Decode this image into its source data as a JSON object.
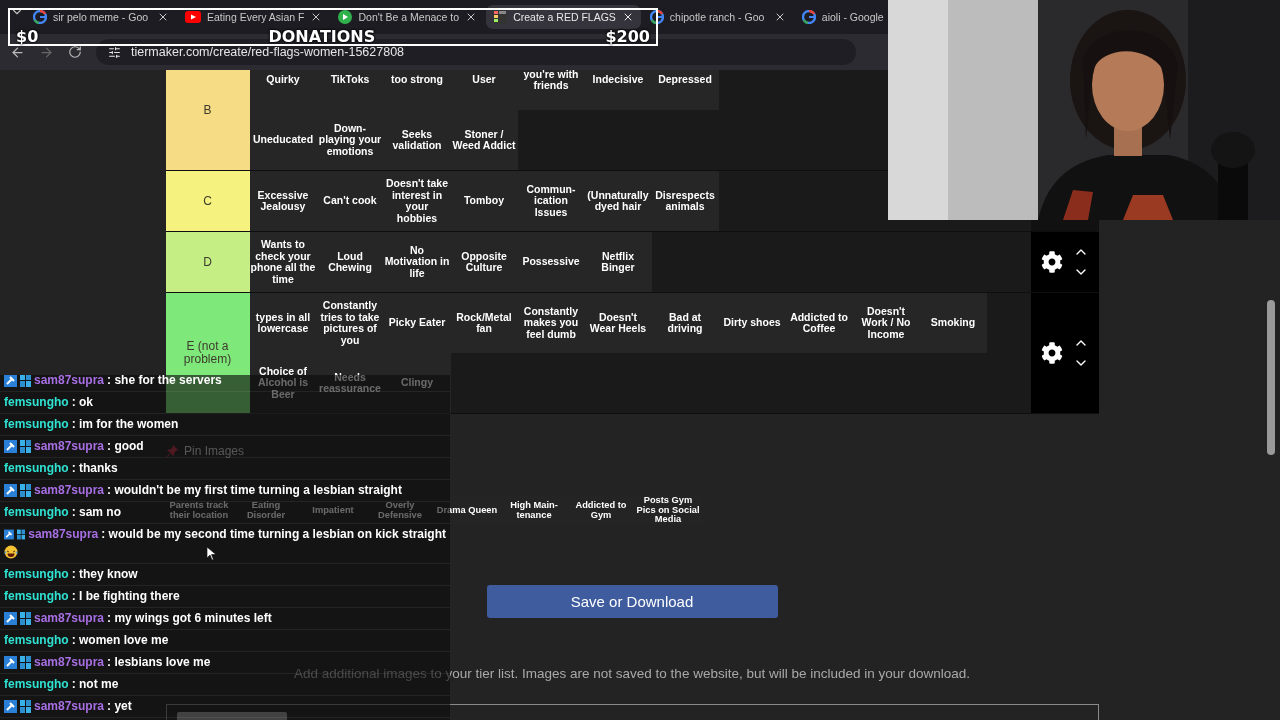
{
  "browser": {
    "tabs": [
      {
        "title": "sir pelo meme - Goo",
        "kind": "google",
        "selected": false
      },
      {
        "title": "Eating Every Asian F",
        "kind": "video",
        "selected": false
      },
      {
        "title": "Don't Be a Menace to",
        "kind": "play",
        "selected": false
      },
      {
        "title": "Create a RED FLAGS",
        "kind": "grid",
        "selected": true
      },
      {
        "title": "chipotle ranch - Goo",
        "kind": "google",
        "selected": false
      },
      {
        "title": "aioli - Google",
        "kind": "google",
        "selected": false
      }
    ],
    "url": "tiermaker.com/create/red-flags-women-15627808"
  },
  "donations": {
    "start": "$0",
    "title": "DONATIONS",
    "goal": "$200",
    "level": 0
  },
  "tier_list": {
    "tiers": [
      {
        "label": "B",
        "color": "#f7dc86",
        "lines": [
          [
            "Quirky",
            "TikToks",
            "too strong",
            "User",
            "you're with friends",
            "Indecisive",
            "Depressed"
          ],
          [
            "Uneducated",
            "Down-playing your emotions",
            "Seeks validation",
            "Stoner / Weed Addict"
          ]
        ]
      },
      {
        "label": "C",
        "color": "#f6f27f",
        "lines": [
          [
            "Excessive Jealousy",
            "Can't cook",
            "Doesn't take interest in your hobbies",
            "Tomboy",
            "Commun-ication Issues",
            "(Unnaturally dyed hair",
            "Disrespects animals"
          ]
        ]
      },
      {
        "label": "D",
        "color": "#c5ef84",
        "controls": true,
        "lines": [
          [
            "Wants to check your phone all the time",
            "Loud Chewing",
            "No Motivation in life",
            "Opposite Culture",
            "Possessive",
            "Netflix Binger"
          ]
        ]
      },
      {
        "label": "E (not a problem)",
        "color": "#7fe87a",
        "controls": true,
        "lines": [
          [
            "types in all lowercase",
            "Constantly tries to take pictures of you",
            "Picky Eater",
            "Rock/Metal fan",
            "Constantly makes you feel dumb",
            "Doesn't Wear Heels",
            "Bad at driving",
            "Dirty shoes",
            "Addicted to Coffee",
            "Doesn't Work / No Income",
            "Smoking"
          ],
          [
            "Choice of Alcohol is Beer",
            "Needs reassurance",
            "Clingy"
          ]
        ]
      }
    ]
  },
  "pin_images": "Pin Images",
  "unplaced_items": [
    "Parents track their location",
    "Eating Disorder",
    "Impatient",
    "Overly Defensive",
    "Drama Queen",
    "High Main-tenance",
    "Addicted to Gym",
    "Posts Gym Pics on Social Media"
  ],
  "save_button": "Save or Download",
  "help_text": "Add additional images to your tier list. Images are not saved to the website, but will be included in your download.",
  "chat": [
    {
      "user": "sam87supra",
      "color": "#a76fe3",
      "badged": true,
      "text": ": she for the servers",
      "emote": false
    },
    {
      "user": "femsungho",
      "color": "#2fe3d3",
      "badged": false,
      "text": ": ok",
      "emote": false
    },
    {
      "user": "femsungho",
      "color": "#2fe3d3",
      "badged": false,
      "text": ": im for the women",
      "emote": false
    },
    {
      "user": "sam87supra",
      "color": "#a76fe3",
      "badged": true,
      "text": ": good",
      "emote": false
    },
    {
      "user": "femsungho",
      "color": "#2fe3d3",
      "badged": false,
      "text": ": thanks",
      "emote": false
    },
    {
      "user": "sam87supra",
      "color": "#a76fe3",
      "badged": true,
      "text": ": wouldn't be my first time turning a lesbian straight",
      "emote": false
    },
    {
      "user": "femsungho",
      "color": "#2fe3d3",
      "badged": false,
      "text": ": sam no",
      "emote": false
    },
    {
      "user": "sam87supra",
      "color": "#a76fe3",
      "badged": true,
      "text": ": would be my second time turning a lesbian on kick straight",
      "emote": true
    },
    {
      "user": "femsungho",
      "color": "#2fe3d3",
      "badged": false,
      "text": ": they know",
      "emote": false
    },
    {
      "user": "femsungho",
      "color": "#2fe3d3",
      "badged": false,
      "text": ": I be fighting there",
      "emote": false
    },
    {
      "user": "sam87supra",
      "color": "#a76fe3",
      "badged": true,
      "text": ": my wings got 6 minutes left",
      "emote": false
    },
    {
      "user": "femsungho",
      "color": "#2fe3d3",
      "badged": false,
      "text": ": women love me",
      "emote": false
    },
    {
      "user": "sam87supra",
      "color": "#a76fe3",
      "badged": true,
      "text": ": lesbians love me",
      "emote": false
    },
    {
      "user": "femsungho",
      "color": "#2fe3d3",
      "badged": false,
      "text": ": not me",
      "emote": false
    },
    {
      "user": "sam87supra",
      "color": "#a76fe3",
      "badged": true,
      "text": ": yet",
      "emote": false
    }
  ]
}
